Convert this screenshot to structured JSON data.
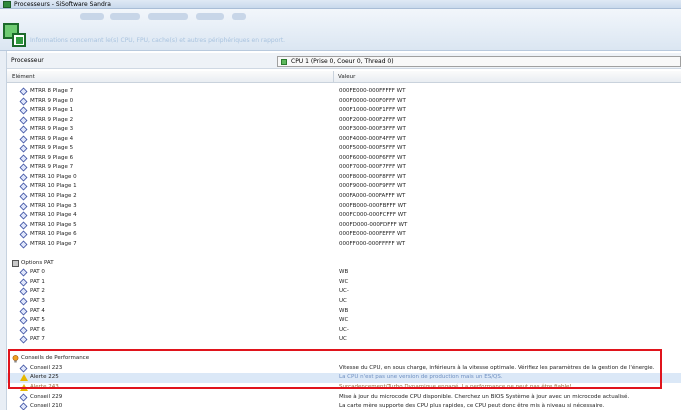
{
  "window": {
    "title": "Processeurs - SiSoftware Sandra"
  },
  "header": {
    "subtitle": "Informations concernant le(s) CPU, FPU, cache(s) et autres périphériques en rapport."
  },
  "selector": {
    "label": "Processeur",
    "value": "CPU 1 (Prise 0, Coeur 0, Thread 0)"
  },
  "table": {
    "col_element": "Elément",
    "col_value": "Valeur",
    "mtrr_rows": [
      {
        "name": "MTRR 8 Plage 7",
        "value": "000FE000-000FFFFF WT"
      },
      {
        "name": "MTRR 9 Plage 0",
        "value": "000F0000-000F0FFF WT"
      },
      {
        "name": "MTRR 9 Plage 1",
        "value": "000F1000-000F1FFF WT"
      },
      {
        "name": "MTRR 9 Plage 2",
        "value": "000F2000-000F2FFF WT"
      },
      {
        "name": "MTRR 9 Plage 3",
        "value": "000F3000-000F3FFF WT"
      },
      {
        "name": "MTRR 9 Plage 4",
        "value": "000F4000-000F4FFF WT"
      },
      {
        "name": "MTRR 9 Plage 5",
        "value": "000F5000-000F5FFF WT"
      },
      {
        "name": "MTRR 9 Plage 6",
        "value": "000F6000-000F6FFF WT"
      },
      {
        "name": "MTRR 9 Plage 7",
        "value": "000F7000-000F7FFF WT"
      },
      {
        "name": "MTRR 10 Plage 0",
        "value": "000F8000-000F8FFF WT"
      },
      {
        "name": "MTRR 10 Plage 1",
        "value": "000F9000-000F9FFF WT"
      },
      {
        "name": "MTRR 10 Plage 2",
        "value": "000FA000-000FAFFF WT"
      },
      {
        "name": "MTRR 10 Plage 3",
        "value": "000FB000-000FBFFF WT"
      },
      {
        "name": "MTRR 10 Plage 4",
        "value": "000FC000-000FCFFF WT"
      },
      {
        "name": "MTRR 10 Plage 5",
        "value": "000FD000-000FDFFF WT"
      },
      {
        "name": "MTRR 10 Plage 6",
        "value": "000FE000-000FEFFF WT"
      },
      {
        "name": "MTRR 10 Plage 7",
        "value": "000FF000-000FFFFF WT"
      }
    ],
    "pat_section": "Options PAT",
    "pat_rows": [
      {
        "name": "PAT 0",
        "value": "WB"
      },
      {
        "name": "PAT 1",
        "value": "WC"
      },
      {
        "name": "PAT 2",
        "value": "UC-"
      },
      {
        "name": "PAT 3",
        "value": "UC"
      },
      {
        "name": "PAT 4",
        "value": "WB"
      },
      {
        "name": "PAT 5",
        "value": "WC"
      },
      {
        "name": "PAT 6",
        "value": "UC-"
      },
      {
        "name": "PAT 7",
        "value": "UC"
      }
    ],
    "perf_section": "Conseils de Performance",
    "perf_rows": [
      {
        "name": "Conseil 223",
        "value": "Vitesse du CPU, en sous charge, inférieurs à la vitesse optimale. Vérifiez les paramètres de la gestion de l'énergie."
      },
      {
        "name": "Alerte 225",
        "value": "La CPU n'est pas une version de production mais un ES/QS."
      },
      {
        "name": "Alerte 243",
        "value": "Surcadençement/Turbo Dynamique engagé. La performance ne peut pas être fiable!"
      },
      {
        "name": "Conseil 229",
        "value": "Mise à jour du microcode CPU disponible. Cherchez un BIOS Système à jour avec un microcode actualisé."
      },
      {
        "name": "Conseil 210",
        "value": "La carte mère supporte des CPU plus rapides, ce CPU peut donc être mis à niveau si nécessaire."
      }
    ]
  }
}
